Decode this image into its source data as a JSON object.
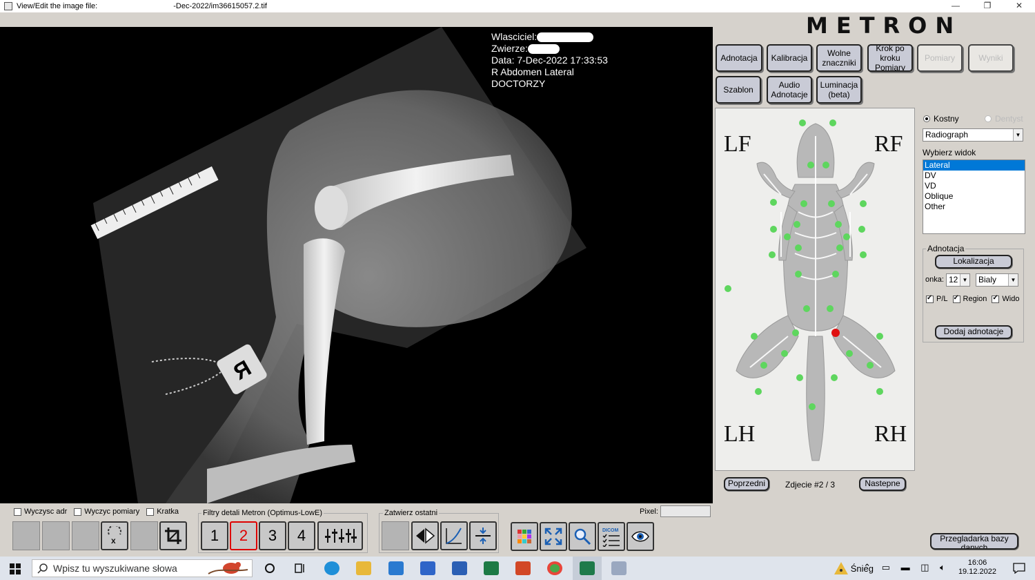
{
  "window": {
    "title": "View/Edit the image file:                                    -Dec-2022/im36615057.2.tif",
    "controls": [
      "—",
      "❐",
      "✕"
    ]
  },
  "overlay": {
    "owner_label": "Wlasciciel:",
    "animal_label": "Zwierze:",
    "date": "Data: 7-Dec-2022  17:33:53",
    "view": "R Abdomen Lateral",
    "clinic": "DOCTORZY"
  },
  "brand": "METRON",
  "toolbar": {
    "row1": [
      "Adnotacja",
      "Kalibracja",
      "Wolne znaczniki",
      "Krok po kroku Pomiary",
      "Pomiary",
      "Wyniki"
    ],
    "row2": [
      "Szablon",
      "Audio Adnotacje",
      "Luminacja (beta)"
    ]
  },
  "skeleton": {
    "corners": {
      "lf": "LF",
      "rf": "RF",
      "lh": "LH",
      "rh": "RH"
    }
  },
  "navigation": {
    "prev": "Poprzedni",
    "status": "Zdjecie #2 / 3",
    "next": "Nastepne"
  },
  "mode": {
    "kostny": "Kostny",
    "dentyst": "Dentyst",
    "modality": "Radiograph",
    "view_label": "Wybierz widok",
    "views": [
      "Lateral",
      "DV",
      "VD",
      "Oblique",
      "Other"
    ],
    "selected_view": "Lateral"
  },
  "annotation": {
    "group_label": "Adnotacja",
    "localize_button": "Lokalizacja",
    "font_label": "onka:",
    "font_size": "12",
    "color": "Bialy",
    "checks": [
      "P/L",
      "Region",
      "Wido"
    ],
    "add_button": "Dodaj adnotacje"
  },
  "bottom": {
    "checks": [
      "Wyczysc adr",
      "Wyczyc pomiary",
      "Kratka"
    ],
    "filters_label": "Filtry detali Metron (Optimus-LowE)",
    "filters": [
      "1",
      "2",
      "3",
      "4"
    ],
    "active_filter": "2",
    "confirm_label": "Zatwierz ostatni",
    "pixel_label": "Pixel:",
    "dicom_label": "DICOM",
    "db_button": "Przegladarka bazy danych"
  },
  "taskbar": {
    "search_placeholder": "Wpisz tu wyszukiwane słowa",
    "weather": "Śnieg",
    "time": "16:06",
    "date": "19.12.2022"
  },
  "colors": {
    "panel_bg": "#d6d2cc",
    "button_bg": "#c9cbd6",
    "selection": "#0078d7",
    "marker_green": "#5ed65e",
    "marker_red": "#e01010"
  }
}
